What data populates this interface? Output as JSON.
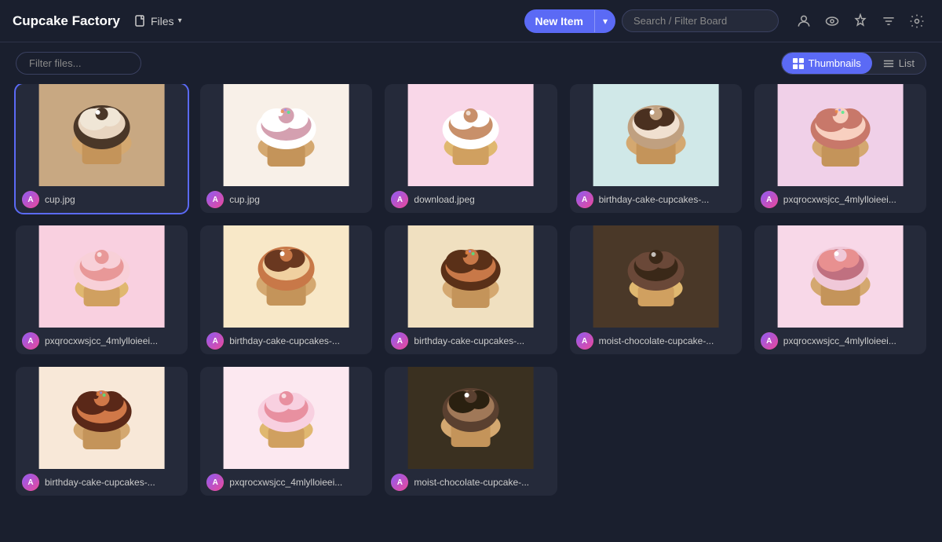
{
  "header": {
    "title": "Cupcake Factory",
    "files_label": "Files",
    "new_item_label": "New Item",
    "search_placeholder": "Search / Filter Board",
    "icons": [
      "user-icon",
      "eye-icon",
      "pin-icon",
      "filter-icon",
      "settings-icon"
    ]
  },
  "toolbar": {
    "filter_placeholder": "Filter files...",
    "view_thumbnails_label": "Thumbnails",
    "view_list_label": "List",
    "active_view": "thumbnails"
  },
  "items": [
    {
      "id": 1,
      "name": "cup.jpg",
      "bg": "#c8b09a",
      "selected": true,
      "colors": [
        "#c8a882",
        "#f0e6d6",
        "#4a3728",
        "#e8d5c0"
      ]
    },
    {
      "id": 2,
      "name": "cup.jpg",
      "bg": "#f8f0e8",
      "selected": false,
      "colors": [
        "#f8f0e8",
        "#fff",
        "#d4a0b0",
        "#e8c8a0"
      ]
    },
    {
      "id": 3,
      "name": "download.jpeg",
      "bg": "#f9d7e8",
      "selected": false,
      "colors": [
        "#f9d7e8",
        "#c8906a",
        "#fff",
        "#e8b090"
      ]
    },
    {
      "id": 4,
      "name": "birthday-cake-cupcakes-...",
      "bg": "#d0e8e8",
      "selected": false,
      "colors": [
        "#d0e8e8",
        "#4a3020",
        "#c0a080",
        "#f0e0d0"
      ]
    },
    {
      "id": 5,
      "name": "pxqrocxwsjcc_4mlylloieei...",
      "bg": "#f0d0e8",
      "selected": false,
      "colors": [
        "#f0d0e8",
        "#c8786a",
        "#f8d0c0",
        "#e0a0b0"
      ]
    },
    {
      "id": 6,
      "name": "pxqrocxwsjcc_4mlylloieei...",
      "bg": "#f9d0e0",
      "selected": false,
      "colors": [
        "#f9d0e0",
        "#e89898",
        "#f8d0d8",
        "#d07080"
      ]
    },
    {
      "id": 7,
      "name": "birthday-cake-cupcakes-...",
      "bg": "#f8e8c8",
      "selected": false,
      "colors": [
        "#f8e8c8",
        "#6a3820",
        "#c87848",
        "#f0d0a0"
      ]
    },
    {
      "id": 8,
      "name": "birthday-cake-cupcakes-...",
      "bg": "#f0e0c0",
      "selected": false,
      "colors": [
        "#f0e0c0",
        "#5a3018",
        "#c87848",
        "#e8c890"
      ]
    },
    {
      "id": 9,
      "name": "moist-chocolate-cupcake-...",
      "bg": "#4a3828",
      "selected": false,
      "colors": [
        "#4a3828",
        "#3a2818",
        "#6a4838",
        "#c09878"
      ]
    },
    {
      "id": 10,
      "name": "pxqrocxwsjcc_4mlylloieei...",
      "bg": "#f8d8e8",
      "selected": false,
      "colors": [
        "#f8d8e8",
        "#e89090",
        "#f0c8d8",
        "#c07080"
      ]
    },
    {
      "id": 11,
      "name": "birthday-cake-cupcakes-...",
      "bg": "#f8e8d8",
      "selected": false,
      "colors": [
        "#f8e8d8",
        "#5a2818",
        "#d07848",
        "#e8c890"
      ]
    },
    {
      "id": 12,
      "name": "pxqrocxwsjcc_4mlylloieei...",
      "bg": "#fce8f0",
      "selected": false,
      "colors": [
        "#fce8f0",
        "#e890a0",
        "#f8d0e0",
        "#c07090"
      ]
    },
    {
      "id": 13,
      "name": "moist-chocolate-cupcake-...",
      "bg": "#3a3020",
      "selected": false,
      "colors": [
        "#3a3020",
        "#2a2010",
        "#5a4030",
        "#a07858"
      ]
    }
  ],
  "avatar": {
    "initials": "A",
    "gradient_start": "#8b5cf6",
    "gradient_end": "#ec4899"
  }
}
